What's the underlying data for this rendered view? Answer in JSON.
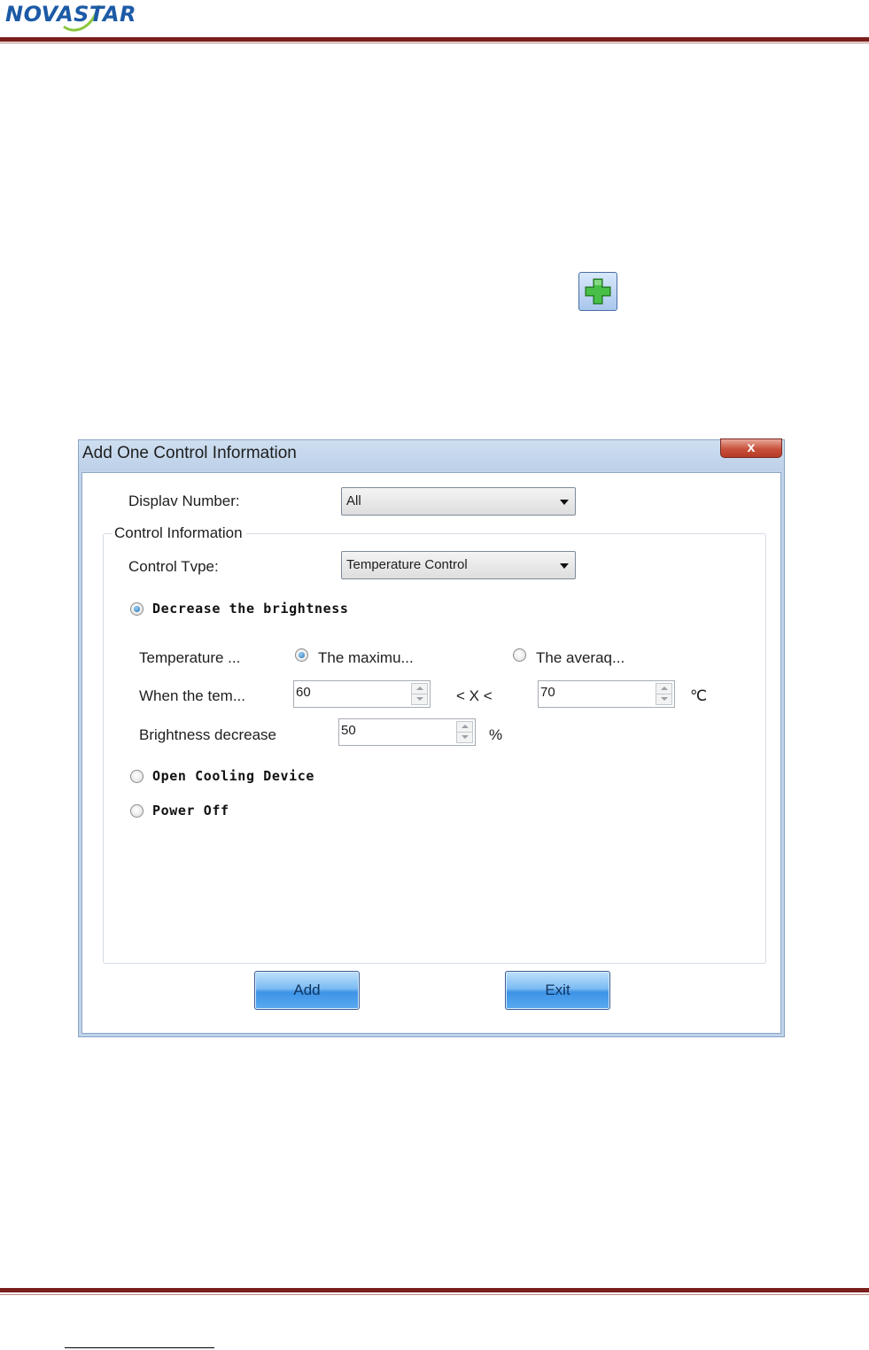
{
  "header": {
    "logo_text_a": "NOVA",
    "logo_text_b": "STAR"
  },
  "icons": {
    "add_icon": "green-plus-icon",
    "close_icon": "close-x-icon",
    "dropdown_icon": "chevron-down-icon"
  },
  "colors": {
    "brand": "#1c5aa6",
    "rule": "#7a1f1b",
    "button": "#5aaaf0"
  },
  "dialog": {
    "title": "Add One Control Information",
    "close_label": "x",
    "display_number_label": "Displav Number:",
    "display_number_value": "All",
    "group_title": "Control Information",
    "control_type_label": "Control Tvpe:",
    "control_type_value": "Temperature Control",
    "option_decrease": "Decrease the brightness",
    "temperature_label": "Temperature ...",
    "temp_max_label": "The maximu...",
    "temp_avg_label": "The averaq...",
    "when_label": "When the tem...",
    "low_value": "60",
    "between_label": "< X <",
    "high_value": "70",
    "temp_unit": "℃",
    "brightness_label": "Brightness decrease",
    "brightness_value": "50",
    "percent_unit": "%",
    "option_cooling": "Open Cooling Device",
    "option_power": "Power Off",
    "add_label": "Add",
    "exit_label": "Exit"
  }
}
